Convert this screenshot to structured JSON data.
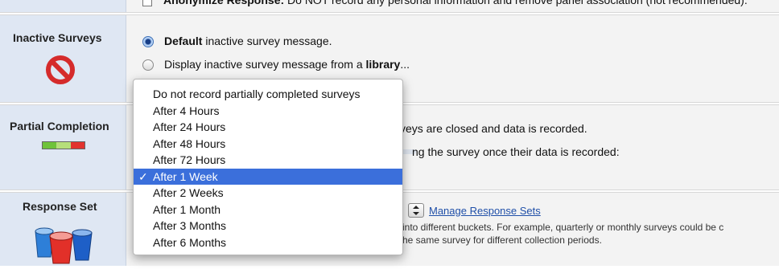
{
  "anonymize": {
    "label_bold": "Anonymize Response:",
    "label_rest": "Do NOT record any personal information and remove panel association (not recommended)."
  },
  "inactive_surveys": {
    "title": "Inactive Surveys",
    "option1_bold": "Default",
    "option1_rest": "inactive survey message.",
    "option2_text": "Display inactive survey message from a",
    "option2_bold": "library",
    "option2_ellipsis": "..."
  },
  "partial_completion": {
    "title": "Partial Completion",
    "bg_line1": "veys are closed and data is recorded.",
    "bg_line2": "ng the survey once their data is recorded:"
  },
  "response_set": {
    "title": "Response Set",
    "manage_link": "Manage Response Sets",
    "desc_line1": "into different buckets. For example, quarterly or monthly surveys could be c",
    "desc_line2": "he same survey for different collection periods."
  },
  "dropdown": {
    "selected_index": 5,
    "check_glyph": "✓",
    "options": [
      "Do not record partially completed surveys",
      "After 4 Hours",
      "After 24 Hours",
      "After 48 Hours",
      "After 72 Hours",
      "After 1 Week",
      "After 2 Weeks",
      "After 1 Month",
      "After 3 Months",
      "After 6 Months"
    ]
  },
  "colors": {
    "selection": "#3b6fdb",
    "link": "#1f4fa8",
    "sidebar": "#dfe7f3"
  }
}
